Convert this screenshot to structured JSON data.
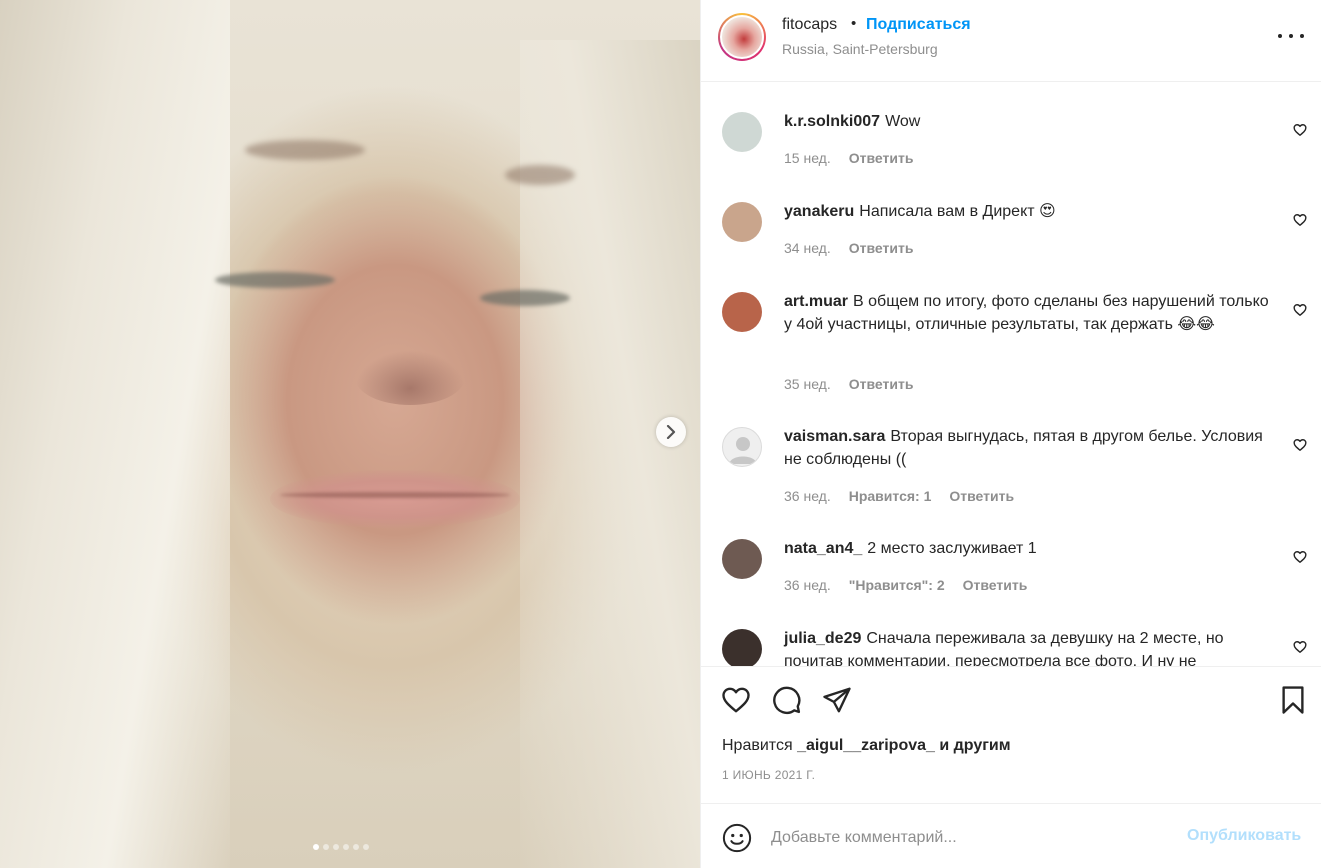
{
  "post": {
    "image_alt": "photo",
    "carousel": {
      "total": 6,
      "active": 0
    }
  },
  "header": {
    "username": "fitocaps",
    "separator": "•",
    "follow_label": "Подписаться",
    "location": "Russia, Saint-Petersburg"
  },
  "comments": [
    {
      "username": "k.r.solnki007",
      "text": "Wow",
      "time": "15 нед.",
      "likes_label": "",
      "reply_label": "Ответить",
      "avatar_color": "#cfd8d4"
    },
    {
      "username": "yanakeru",
      "text": "Написала вам в Директ 😍",
      "time": "34 нед.",
      "likes_label": "",
      "reply_label": "Ответить",
      "avatar_color": "#c9a58c"
    },
    {
      "username": "art.muar",
      "text": "В общем по итогу, фото сделаны без нарушений только у 4ой участницы, отличные результаты, так держать 😂😂",
      "time": "35 нед.",
      "likes_label": "",
      "reply_label": "Ответить",
      "avatar_color": "#b8644a"
    },
    {
      "username": "vaisman.sara",
      "text": "Вторая выгнудась, пятая в другом белье. Условия не соблюдены ((",
      "time": "36 нед.",
      "likes_label": "Нравится: 1",
      "reply_label": "Ответить",
      "avatar_color": "#efefef"
    },
    {
      "username": "nata_an4_",
      "text": "2 место заслуживает 1",
      "time": "36 нед.",
      "likes_label": "\"Нравится\": 2",
      "reply_label": "Ответить",
      "avatar_color": "#6e5a52"
    },
    {
      "username": "julia_de29",
      "text": "Сначала переживала за девушку на 2 месте, но почитав комментарии, пересмотрела все фото. И ну не",
      "time": "",
      "likes_label": "",
      "reply_label": "",
      "avatar_color": "#3b302c"
    }
  ],
  "actions": {
    "like_icon": "heart-icon",
    "comment_icon": "comment-icon",
    "share_icon": "share-icon",
    "save_icon": "bookmark-icon"
  },
  "likes": {
    "prefix": "Нравится",
    "user": "_aigul__zaripova_",
    "suffix": "и другим"
  },
  "date": "1 ИЮНЬ 2021 Г.",
  "add_comment": {
    "placeholder": "Добавьте комментарий...",
    "publish_label": "Опубликовать"
  },
  "colors": {
    "accent": "#0095f6",
    "accent_disabled": "#b2dffc",
    "text": "#262626",
    "muted": "#8e8e8e",
    "border": "#efefef"
  }
}
